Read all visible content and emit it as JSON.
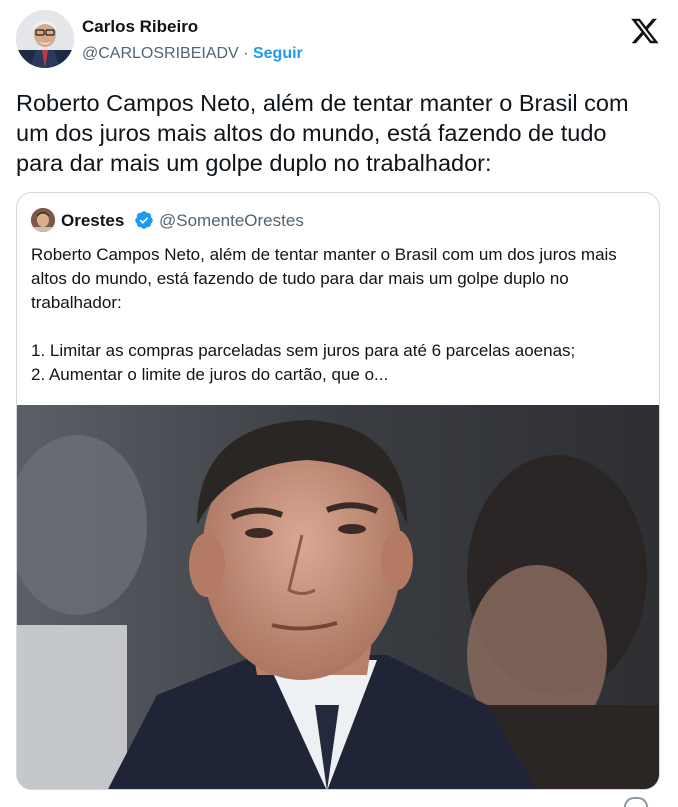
{
  "author": {
    "name": "Carlos Ribeiro",
    "handle": "@CARLOSRIBEIADV",
    "separator": "·",
    "follow_label": "Seguir"
  },
  "brand": {
    "logo": "x-logo-icon"
  },
  "tweet": {
    "text": "Roberto Campos Neto, além de tentar manter o Brasil com um dos juros mais altos do mundo, está fazendo de tudo para dar mais um golpe duplo no trabalhador:"
  },
  "quote": {
    "name": "Orestes",
    "handle": "@SomenteOrestes",
    "verified_icon": "verified-badge-icon",
    "text_intro": "Roberto Campos Neto, além de tentar manter o Brasil com um dos juros mais altos do mundo, está fazendo de tudo para dar mais um golpe duplo no trabalhador:",
    "item1": "1. Limitar as compras parceladas sem juros para até 6 parcelas aoenas;",
    "item2": "2. Aumentar o limite de juros do cartão, que o..."
  },
  "colors": {
    "accent": "#1d9bf0",
    "text": "#0f1419",
    "muted": "#536471",
    "border": "#cfd9de"
  }
}
